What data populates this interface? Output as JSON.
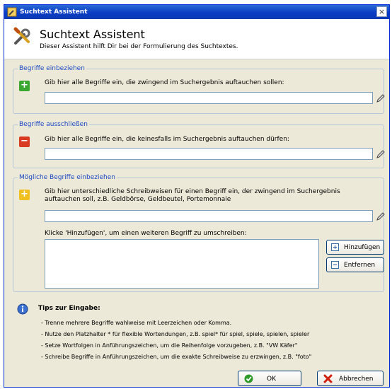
{
  "window": {
    "title": "Suchtext Assistent",
    "close_glyph": "×"
  },
  "header": {
    "title": "Suchtext Assistent",
    "subtitle": "Dieser Assistent hilft Dir bei der Formulierung des Suchtextes.",
    "icon": "wizard-tools-icon"
  },
  "group_include": {
    "legend": "Begriffe einbeziehen",
    "icon": "plus-icon",
    "text": "Gib hier alle Begriffe ein, die zwingend im Suchergebnis auftauchen sollen:",
    "input_value": ""
  },
  "group_exclude": {
    "legend": "Begriffe ausschließen",
    "icon": "minus-icon",
    "text": "Gib hier alle Begriffe ein, die keinesfalls im Suchergebnis auftauchen dürfen:",
    "input_value": ""
  },
  "group_optional": {
    "legend": "Mögliche Begriffe einbeziehen",
    "icon": "optional-icon",
    "text_line1": "Gib hier unterschiedliche Schreibweisen für einen Begriff ein, der zwingend im Suchergebnis",
    "text_line2": "auftauchen soll, z.B. Geldbörse, Geldbeutel, Portemonnaie",
    "input_value": "",
    "hint": "Klicke 'Hinzufügen', um einen weiteren Begriff zu umschreiben:",
    "add_button": "Hinzufügen",
    "remove_button": "Entfernen"
  },
  "tips": {
    "title": "Tips zur Eingabe:",
    "lines": [
      "- Trenne mehrere Begriffe wahlweise mit Leerzeichen oder Komma.",
      "- Nutze den Platzhalter * für flexible Wortendungen, z.B. spiel* für spiel, spiele, spielen, spieler",
      "- Setze Wortfolgen in Anführungszeichen, um die Reihenfolge vorzugeben, z.B. \"VW Käfer\"",
      "- Schreibe Begriffe in Anführungszeichen, um die exakte Schreibweise zu erzwingen, z.B. \"foto\""
    ]
  },
  "footer": {
    "ok": "OK",
    "cancel": "Abbrechen"
  },
  "colors": {
    "titlebar": "#0a3dc4",
    "legend": "#1b48c4",
    "plus": "#3aa830",
    "minus": "#d83a22",
    "optional": "#f0c020"
  }
}
